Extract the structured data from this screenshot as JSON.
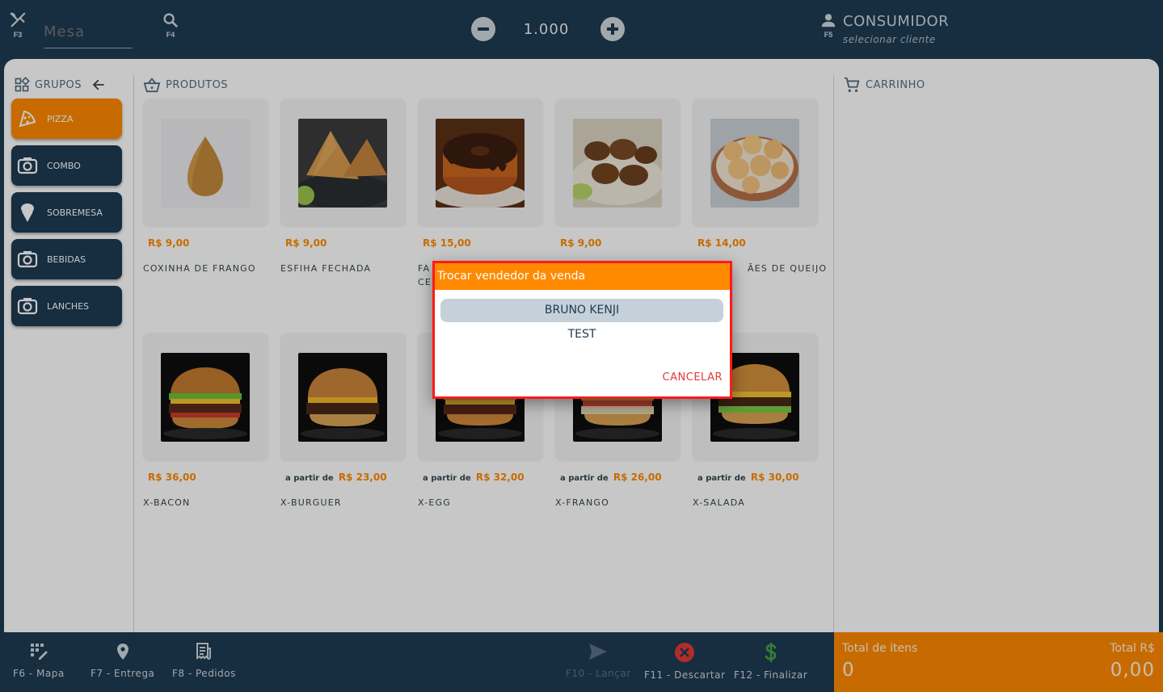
{
  "topbar": {
    "table_key": "F3",
    "table_placeholder": "Mesa",
    "search_key": "F4",
    "quantity": "1.000",
    "customer_key": "F5",
    "customer_title": "CONSUMIDOR",
    "customer_subtitle": "selecionar cliente"
  },
  "groups": {
    "header": "GRUPOS",
    "items": [
      {
        "label": "PIZZA",
        "icon": "pizza-icon",
        "active": true
      },
      {
        "label": "COMBO",
        "icon": "camera-icon",
        "active": false
      },
      {
        "label": "SOBREMESA",
        "icon": "ice-cream-icon",
        "active": false
      },
      {
        "label": "BEBIDAS",
        "icon": "camera-icon",
        "active": false
      },
      {
        "label": "LANCHES",
        "icon": "camera-icon",
        "active": false
      }
    ]
  },
  "products": {
    "header": "PRODUTOS",
    "items": [
      {
        "name": "COXINHA DE FRANGO",
        "price": "R$ 9,00",
        "from": ""
      },
      {
        "name": "ESFIHA FECHADA",
        "price": "R$ 9,00",
        "from": ""
      },
      {
        "name": "FA",
        "name2": "CE",
        "price": "R$ 15,00",
        "from": ""
      },
      {
        "name": "",
        "price": "R$ 9,00",
        "from": ""
      },
      {
        "name": "ÃES DE QUEIJO",
        "price": "R$ 14,00",
        "from": ""
      },
      {
        "name": "X-BACON",
        "price": "R$ 36,00",
        "from": ""
      },
      {
        "name": "X-BURGUER",
        "price": "R$ 23,00",
        "from": "a partir de"
      },
      {
        "name": "X-EGG",
        "price": "R$ 32,00",
        "from": "a partir de"
      },
      {
        "name": "X-FRANGO",
        "price": "R$ 26,00",
        "from": "a partir de"
      },
      {
        "name": "X-SALADA",
        "price": "R$ 30,00",
        "from": "a partir de"
      }
    ]
  },
  "cart": {
    "header": "CARRINHO"
  },
  "bottombar": {
    "map": "F6 - Mapa",
    "delivery": "F7 - Entrega",
    "orders": "F8 - Pedidos",
    "launch": "F10 - Lançar",
    "discard": "F11 - Descartar",
    "finish": "F12 - Finalizar"
  },
  "totals": {
    "items_label": "Total de itens",
    "items_value": "0",
    "amount_label": "Total R$",
    "amount_value": "0,00"
  },
  "dialog": {
    "title": "Trocar vendedor da venda",
    "sellers": [
      "BRUNO KENJI",
      "TEST"
    ],
    "cancel": "CANCELAR"
  },
  "colors": {
    "navy": "#1e3a52",
    "accent_orange": "#ff8a00",
    "danger_red": "#e53935",
    "finish_green": "#43a047"
  }
}
